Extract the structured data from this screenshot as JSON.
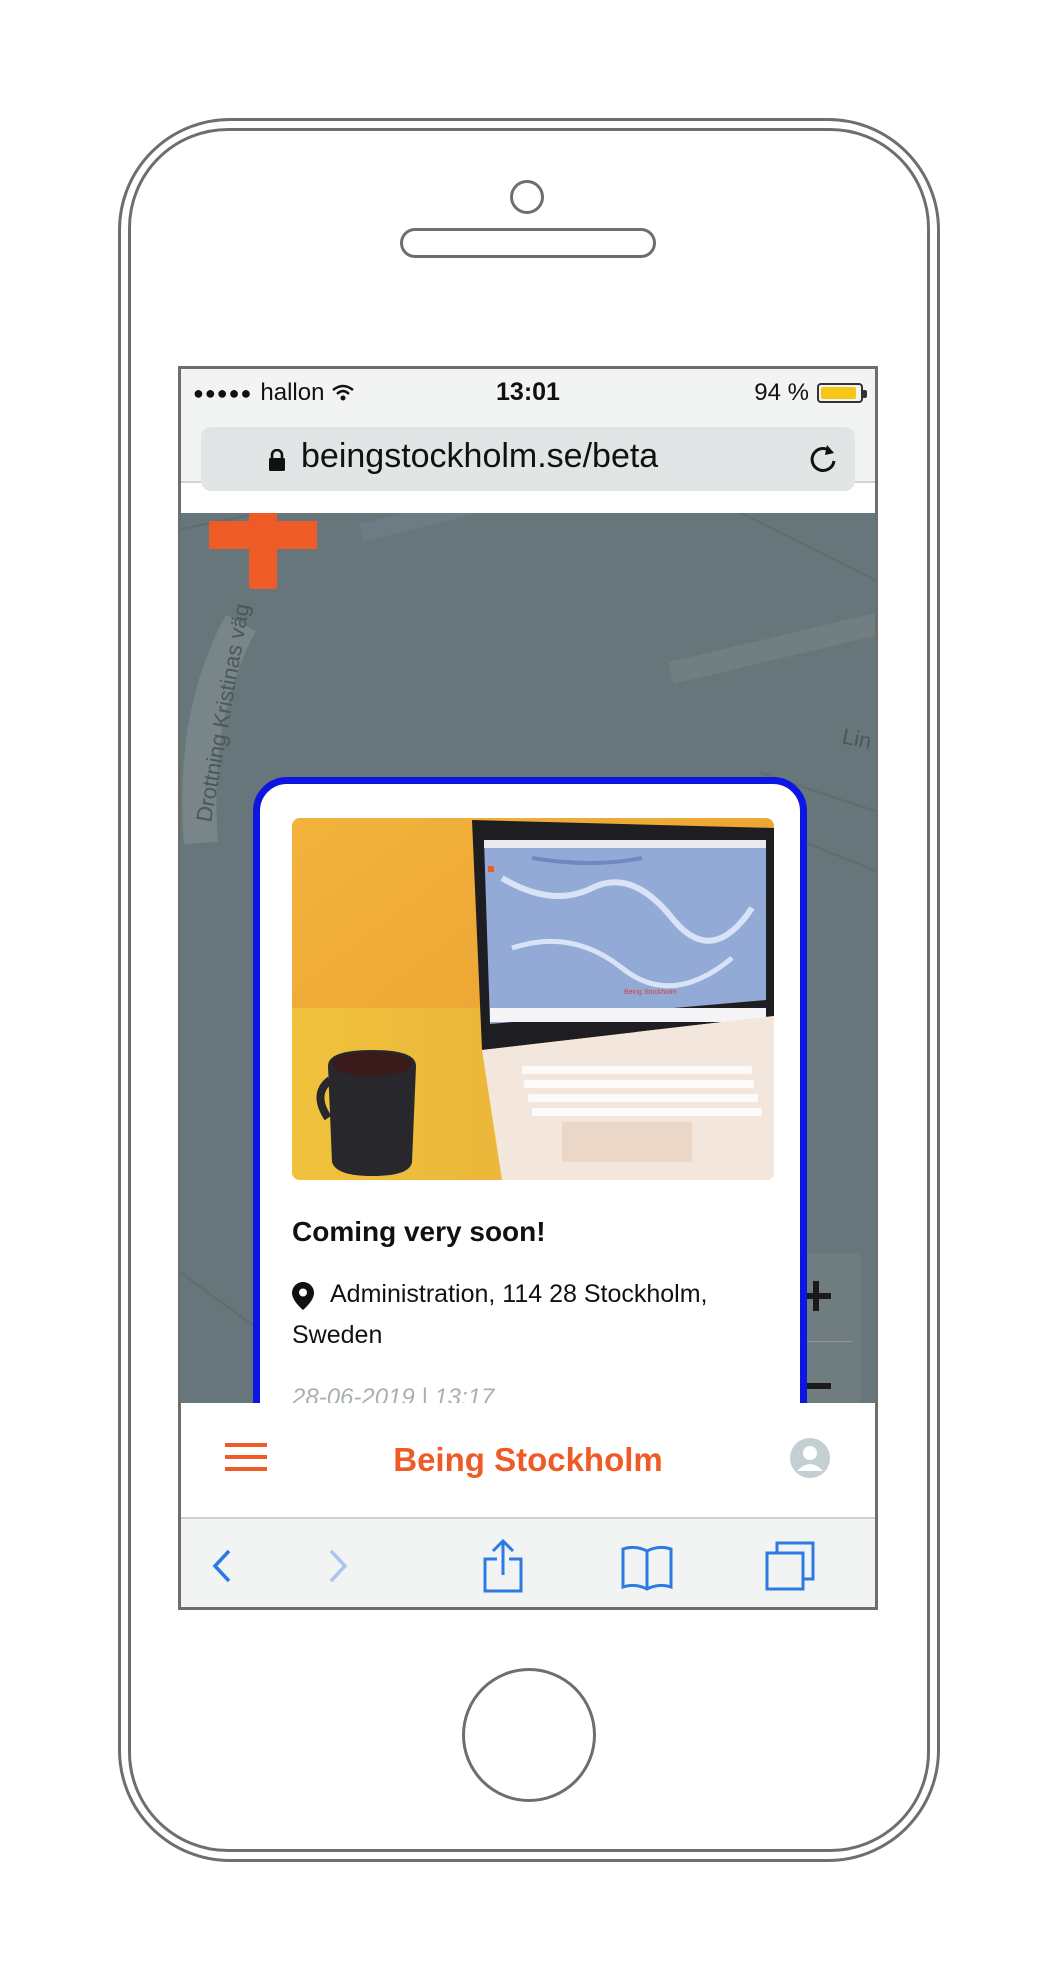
{
  "status_bar": {
    "signal": "●●●●●",
    "carrier": "hallon",
    "time": "13:01",
    "battery_percent": "94 %",
    "battery_level": 0.94
  },
  "browser": {
    "url": "beingstockholm.se/beta"
  },
  "map": {
    "street_labels": [
      "Drottning Kristinas väg",
      "Lin"
    ]
  },
  "card": {
    "title": "Coming very soon!",
    "address": "Administration, 114 28 Stockholm, Sweden",
    "date": "28-06-2019 | 13:17",
    "photo_screen_label": "Being Stockholm"
  },
  "zoom": {
    "in_label": "+",
    "out_label": "−"
  },
  "app_bar": {
    "title": "Being Stockholm"
  },
  "colors": {
    "brand_orange": "#ef5b26",
    "card_border": "#0c16e0",
    "map_background": "#67767a",
    "ios_blue": "#2c7be5"
  },
  "toolbar": {
    "icons": [
      "back-icon",
      "forward-icon",
      "share-icon",
      "bookmarks-icon",
      "tabs-icon"
    ]
  }
}
